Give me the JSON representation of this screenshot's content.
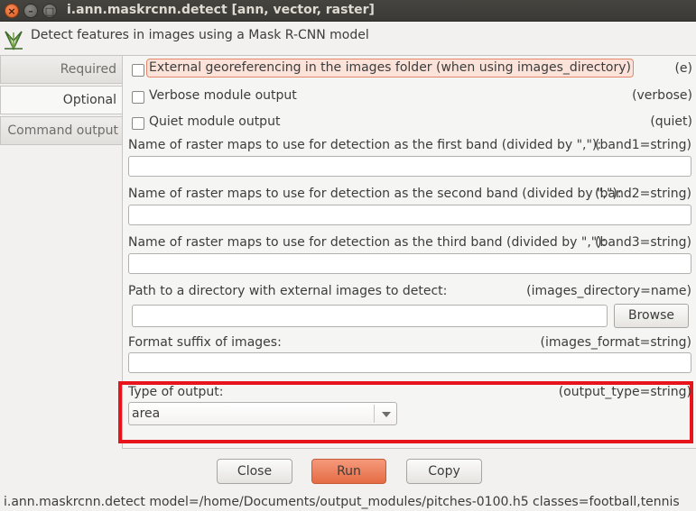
{
  "window": {
    "title": "i.ann.maskrcnn.detect [ann, vector, raster]",
    "close_glyph": "×",
    "minimize_glyph": "–",
    "maximize_glyph": "□"
  },
  "header": {
    "description": "Detect features in images using a Mask R-CNN model",
    "icon": "grass-logo-icon"
  },
  "tabs": [
    {
      "label": "Required",
      "active": false
    },
    {
      "label": "Optional",
      "active": true
    },
    {
      "label": "Command output",
      "active": false
    }
  ],
  "options": {
    "external_georef": {
      "label": "External georeferencing in the images folder (when using images_directory)",
      "flag": "(e)",
      "checked": false
    },
    "verbose": {
      "label": "Verbose module output",
      "flag": "(verbose)",
      "checked": false
    },
    "quiet": {
      "label": "Quiet module output",
      "flag": "(quiet)",
      "checked": false
    },
    "band1": {
      "label": "Name of raster maps to use for detection as the first band (divided by \",\"):",
      "key": "(band1=string)",
      "value": ""
    },
    "band2": {
      "label": "Name of raster maps to use for detection as the second band (divided by \",\"):",
      "key": "(band2=string)",
      "value": ""
    },
    "band3": {
      "label": "Name of raster maps to use for detection as the third band (divided by \",\"):",
      "key": "(band3=string)",
      "value": ""
    },
    "images_directory": {
      "label": "Path to a directory with external images to detect:",
      "key": "(images_directory=name)",
      "value": "",
      "browse_label": "Browse"
    },
    "images_format": {
      "label": "Format suffix of images:",
      "key": "(images_format=string)",
      "value": ""
    },
    "output_type": {
      "label": "Type of output:",
      "key": "(output_type=string)",
      "value": "area"
    }
  },
  "highlight_color": "#e8141b",
  "buttons": {
    "close": "Close",
    "run": "Run",
    "copy": "Copy"
  },
  "run_color": "#e56c45",
  "statusbar": "i.ann.maskrcnn.detect model=/home/Documents/output_modules/pitches-0100.h5 classes=football,tennis"
}
